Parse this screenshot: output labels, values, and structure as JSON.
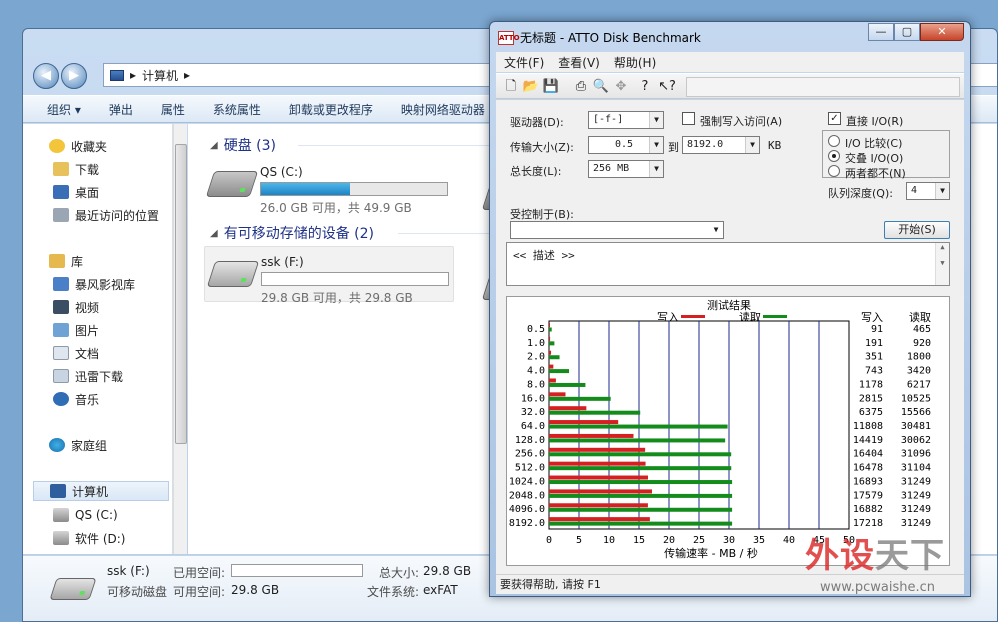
{
  "explorer": {
    "address_path": "计算机",
    "toolbar": [
      "组织 ▾",
      "弹出",
      "属性",
      "系统属性",
      "卸载或更改程序",
      "映射网络驱动器"
    ],
    "nav": {
      "favorites": "收藏夹",
      "favorites_items": [
        "下载",
        "桌面",
        "最近访问的位置"
      ],
      "libraries": "库",
      "libraries_items": [
        "暴风影视库",
        "视频",
        "图片",
        "文档",
        "迅雷下载",
        "音乐"
      ],
      "homegroup": "家庭组",
      "computer": "计算机",
      "computer_items": [
        "QS (C:)",
        "软件 (D:)"
      ]
    },
    "groups": {
      "hdd_title": "硬盘 (3)",
      "removable_title": "有可移动存储的设备 (2)"
    },
    "drives": [
      {
        "name": "QS (C:)",
        "size": "26.0 GB 可用，共 49.9 GB",
        "used_fraction": 0.48
      },
      {
        "name": "ssk (F:)",
        "size": "29.8 GB 可用，共 29.8 GB",
        "used_fraction": 0.0
      }
    ],
    "details": {
      "name": "ssk (F:)",
      "type": "可移动磁盘",
      "used_label": "已用空间:",
      "free_label": "可用空间:",
      "free_value": "29.8 GB",
      "total_label": "总大小:",
      "total_value": "29.8 GB",
      "fs_label": "文件系统:",
      "fs_value": "exFAT"
    }
  },
  "atto": {
    "title": "无标题 - ATTO Disk Benchmark",
    "menu": [
      "文件(F)",
      "查看(V)",
      "帮助(H)"
    ],
    "drive_label": "驱动器(D):",
    "drive_value": "[-f-]",
    "force_write_label": "强制写入访问(A)",
    "transfer_label": "传输大小(Z):",
    "transfer_from": "0.5",
    "transfer_to_label": "到",
    "transfer_to": "8192.0",
    "transfer_unit": "KB",
    "length_label": "总长度(L):",
    "length_value": "256 MB",
    "direct_io_label": "直接 I/O(R)",
    "io_compare_label": "I/O 比较(C)",
    "overlap_io_label": "交叠 I/O(O)",
    "neither_label": "两者都不(N)",
    "queue_label": "队列深度(Q):",
    "queue_value": "4",
    "controlled_label": "受控制于(B):",
    "start_button": "开始(S)",
    "description": "<< 描述 >>",
    "status": "要获得帮助, 请按 F1",
    "colors": {
      "write": "#d42020",
      "read": "#148c1c"
    }
  },
  "chart_data": {
    "type": "bar",
    "title": "测试结果",
    "legend": [
      "写入",
      "读取"
    ],
    "xlabel": "传输速率 - MB / 秒",
    "xlim": [
      0,
      50
    ],
    "xticks": [
      0,
      5,
      10,
      15,
      20,
      25,
      30,
      35,
      40,
      45,
      50
    ],
    "categories": [
      "0.5",
      "1.0",
      "2.0",
      "4.0",
      "8.0",
      "16.0",
      "32.0",
      "64.0",
      "128.0",
      "256.0",
      "512.0",
      "1024.0",
      "2048.0",
      "4096.0",
      "8192.0"
    ],
    "column_headers": [
      "写入",
      "读取"
    ],
    "series": [
      {
        "name": "写入",
        "values": [
          91,
          191,
          351,
          743,
          1178,
          2815,
          6375,
          11808,
          14419,
          16404,
          16478,
          16893,
          17579,
          16882,
          17218
        ]
      },
      {
        "name": "读取",
        "values": [
          465,
          920,
          1800,
          3420,
          6217,
          10525,
          15566,
          30481,
          30062,
          31096,
          31104,
          31249,
          31249,
          31249,
          31249
        ]
      }
    ]
  },
  "watermark": {
    "text_red": "外设",
    "text_gray": "天下",
    "url": "www.pcwaishe.cn"
  }
}
